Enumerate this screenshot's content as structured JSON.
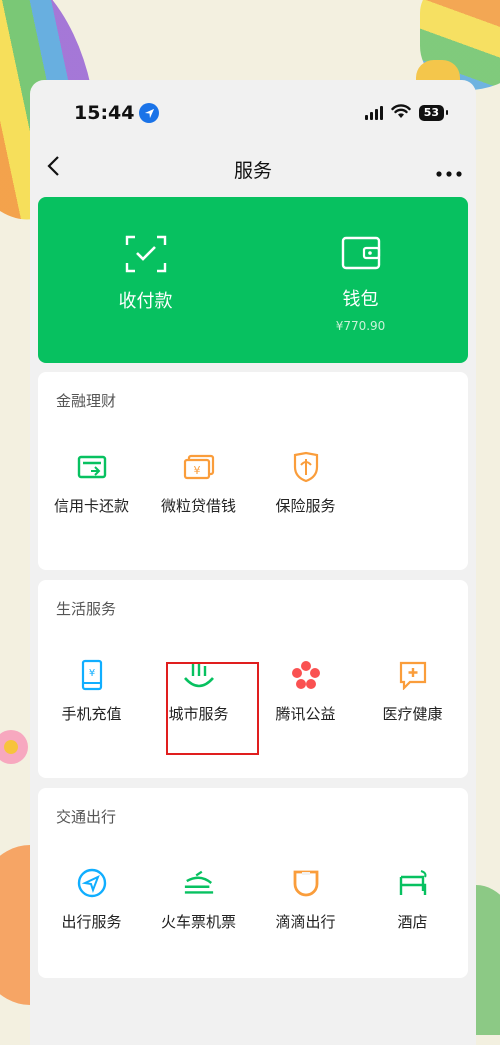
{
  "status_bar": {
    "time": "15:44",
    "battery": "53"
  },
  "nav": {
    "title": "服务",
    "back": "‹",
    "more": "•••"
  },
  "wallet_card": {
    "pay_label": "收付款",
    "wallet_label": "钱包",
    "wallet_balance": "¥770.90"
  },
  "sections": [
    {
      "title": "金融理财",
      "items": [
        {
          "label": "信用卡还款",
          "icon": "credit-card-icon"
        },
        {
          "label": "微粒贷借钱",
          "icon": "loan-icon"
        },
        {
          "label": "保险服务",
          "icon": "insurance-icon"
        }
      ]
    },
    {
      "title": "生活服务",
      "items": [
        {
          "label": "手机充值",
          "icon": "phone-recharge-icon"
        },
        {
          "label": "城市服务",
          "icon": "city-service-icon"
        },
        {
          "label": "腾讯公益",
          "icon": "charity-icon"
        },
        {
          "label": "医疗健康",
          "icon": "medical-icon"
        }
      ]
    },
    {
      "title": "交通出行",
      "items": [
        {
          "label": "出行服务",
          "icon": "travel-icon"
        },
        {
          "label": "火车票机票",
          "icon": "train-icon"
        },
        {
          "label": "滴滴出行",
          "icon": "didi-icon"
        },
        {
          "label": "酒店",
          "icon": "hotel-icon"
        }
      ]
    }
  ],
  "colors": {
    "wechat_green": "#07c160",
    "icon_green": "#07c160",
    "icon_orange": "#fa9d3b",
    "icon_blue": "#10aeff",
    "icon_red": "#fa5151",
    "highlight": "#e01e1e"
  }
}
